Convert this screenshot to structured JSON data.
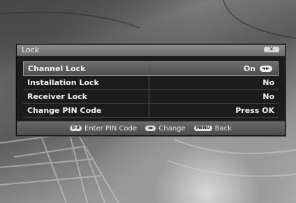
{
  "window": {
    "title": "Lock"
  },
  "rows": [
    {
      "label": "Channel Lock",
      "value": "On"
    },
    {
      "label": "Installation Lock",
      "value": "No"
    },
    {
      "label": "Receiver Lock",
      "value": "No"
    },
    {
      "label": "Change PIN Code",
      "value": "Press OK"
    }
  ],
  "footer": {
    "hints": [
      {
        "key": "0-9",
        "text": "Enter PIN Code"
      },
      {
        "key": "◄►",
        "text": "Change"
      },
      {
        "key": "MENU",
        "text": "Back"
      }
    ]
  },
  "icons": {
    "close": "close-icon",
    "left_right": "left-right-arrows-icon"
  },
  "colors": {
    "panel": "#1c1c1c",
    "titlebar": "#7a7a7a",
    "selection": "#5c5c5c",
    "text": "#f4f4f4"
  }
}
